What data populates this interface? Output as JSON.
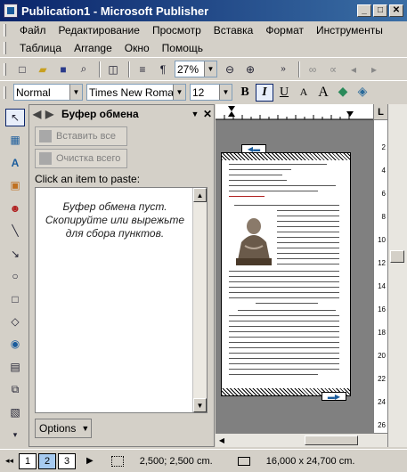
{
  "window": {
    "title": "Publication1 - Microsoft Publisher",
    "min_glyph": "_",
    "max_glyph": "□",
    "close_glyph": "✕"
  },
  "menu": {
    "row1": [
      "Файл",
      "Редактирование",
      "Просмотр",
      "Вставка",
      "Формат",
      "Инструменты"
    ],
    "row2": [
      "Таблица",
      "Arrange",
      "Окно",
      "Помощь"
    ]
  },
  "standard_toolbar": {
    "zoom_value": "27%"
  },
  "format_toolbar": {
    "style_value": "Normal",
    "font_value": "Times New Roman",
    "size_value": "12",
    "bold_label": "B",
    "italic_label": "I",
    "underline_label": "U"
  },
  "task_pane": {
    "title": "Буфер обмена",
    "paste_all_label": "Вставить все",
    "clear_all_label": "Очистка всего",
    "hint": "Click an item to paste:",
    "empty_message": "Буфер обмена пуст. Скопируйте или вырежьте для сбора пунктов.",
    "options_label": "Options"
  },
  "ruler": {
    "corner_label": "L",
    "vertical_numbers": [
      "2",
      "4",
      "6",
      "8",
      "10",
      "12",
      "14",
      "16",
      "18",
      "20",
      "22",
      "24",
      "26"
    ]
  },
  "status": {
    "pages": [
      "1",
      "2",
      "3"
    ],
    "active_page": "2",
    "position": "2,500; 2,500 cm.",
    "size": "16,000 x 24,700 cm."
  }
}
